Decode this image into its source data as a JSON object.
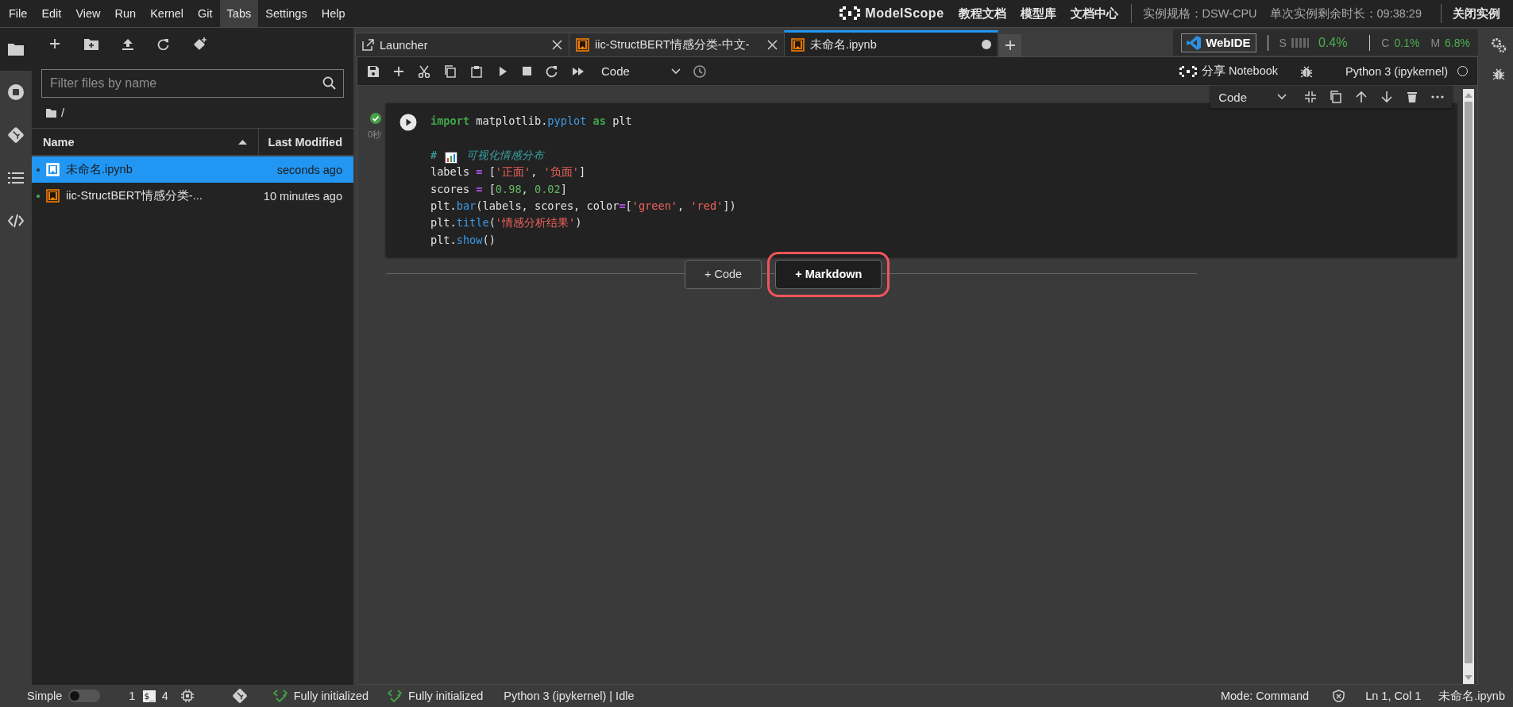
{
  "menu_bar": {
    "items": [
      {
        "label": "File",
        "selected": false
      },
      {
        "label": "Edit",
        "selected": false
      },
      {
        "label": "View",
        "selected": false
      },
      {
        "label": "Run",
        "selected": false
      },
      {
        "label": "Kernel",
        "selected": false
      },
      {
        "label": "Git",
        "selected": false
      },
      {
        "label": "Tabs",
        "selected": true
      },
      {
        "label": "Settings",
        "selected": false
      },
      {
        "label": "Help",
        "selected": false
      }
    ],
    "logo": "ModelScope",
    "links": [
      "教程文档",
      "模型库",
      "文档中心"
    ],
    "instance_spec": "实例规格：DSW-CPU",
    "remaining_time": "单次实例剩余时长：09:38:29",
    "close_button": "关闭实例"
  },
  "left_sidebar": {
    "tabs": [
      {
        "selected": true
      },
      {
        "selected": false
      },
      {
        "selected": false
      },
      {
        "selected": false
      },
      {
        "selected": false
      }
    ]
  },
  "file_browser": {
    "filter": {
      "placeholder": "Filter files by name"
    },
    "breadcrumb": "/",
    "columns": [
      {
        "label": "Name",
        "sorted": true
      },
      {
        "label": "Last Modified",
        "sorted": false
      }
    ],
    "rows": [
      {
        "name": "未命名.ipynb",
        "modified": "seconds ago",
        "selected": true,
        "running": true
      },
      {
        "name": "iic-StructBERT情感分类-...",
        "modified": "10 minutes ago",
        "selected": false,
        "running": true
      }
    ]
  },
  "dock": {
    "tabs": [
      {
        "label": "Launcher",
        "kind": "launcher",
        "selected": false,
        "dirty": false
      },
      {
        "label": "iic-StructBERT情感分类-中文-",
        "kind": "notebook",
        "selected": false,
        "dirty": false
      },
      {
        "label": "未命名.ipynb",
        "kind": "notebook",
        "selected": true,
        "dirty": true
      }
    ],
    "resources": {
      "webide_button": "WebIDE",
      "storage_label": "S",
      "storage_value": "0.4%",
      "cpu_label": "C",
      "cpu_value": "0.1%",
      "mem_label": "M",
      "mem_value": "6.8%"
    },
    "toolbar": {
      "cell_type": "Code",
      "share": "分享 Notebook",
      "kernel": "Python 3 (ipykernel)",
      "kernel_busy": false
    }
  },
  "cell": {
    "toolbar_cell_type": "Code",
    "succeeded": true,
    "elapsed": "0秒",
    "lines": [
      {
        "gap_before": false,
        "tokens": [
          {
            "text": "import",
            "kind": "kw"
          },
          {
            "text": " matplotlib.",
            "kind": "name"
          },
          {
            "text": "pyplot",
            "kind": "attr"
          },
          {
            "text": " as",
            "kind": "kw"
          },
          {
            "text": " plt",
            "kind": "name"
          }
        ]
      },
      {
        "gap_before": true,
        "tokens": [
          {
            "text": "# ",
            "kind": "comment"
          },
          {
            "kind": "icon"
          },
          {
            "text": " 可视化情感分布",
            "kind": "comment"
          }
        ]
      },
      {
        "gap_before": false,
        "tokens": [
          {
            "text": "labels ",
            "kind": "name"
          },
          {
            "text": "=",
            "kind": "op"
          },
          {
            "text": " [",
            "kind": "name"
          },
          {
            "text": "'正面'",
            "kind": "str"
          },
          {
            "text": ", ",
            "kind": "name"
          },
          {
            "text": "'负面'",
            "kind": "str"
          },
          {
            "text": "]",
            "kind": "name"
          }
        ]
      },
      {
        "gap_before": false,
        "tokens": [
          {
            "text": "scores ",
            "kind": "name"
          },
          {
            "text": "=",
            "kind": "op"
          },
          {
            "text": " [",
            "kind": "name"
          },
          {
            "text": "0.98",
            "kind": "num"
          },
          {
            "text": ", ",
            "kind": "name"
          },
          {
            "text": "0.02",
            "kind": "num"
          },
          {
            "text": "]",
            "kind": "name"
          }
        ]
      },
      {
        "gap_before": false,
        "tokens": [
          {
            "text": "plt.",
            "kind": "name"
          },
          {
            "text": "bar",
            "kind": "attr"
          },
          {
            "text": "(labels, scores, color",
            "kind": "name"
          },
          {
            "text": "=",
            "kind": "op"
          },
          {
            "text": "[",
            "kind": "name"
          },
          {
            "text": "'green'",
            "kind": "str"
          },
          {
            "text": ", ",
            "kind": "name"
          },
          {
            "text": "'red'",
            "kind": "str"
          },
          {
            "text": "])",
            "kind": "name"
          }
        ]
      },
      {
        "gap_before": false,
        "tokens": [
          {
            "text": "plt.",
            "kind": "name"
          },
          {
            "text": "title",
            "kind": "attr"
          },
          {
            "text": "(",
            "kind": "name"
          },
          {
            "text": "'情感分析结果'",
            "kind": "str"
          },
          {
            "text": ")",
            "kind": "name"
          }
        ]
      },
      {
        "gap_before": false,
        "tokens": [
          {
            "text": "plt.",
            "kind": "name"
          },
          {
            "text": "show",
            "kind": "attr"
          },
          {
            "text": "()",
            "kind": "name"
          }
        ]
      }
    ]
  },
  "add_buttons": [
    {
      "label": "+ Code",
      "highlighted": false
    },
    {
      "label": "+ Markdown",
      "highlighted": true
    }
  ],
  "status_bar": {
    "simple_mode": {
      "label": "Simple",
      "on": false
    },
    "terminals": "1",
    "terminal_icon": "$_",
    "kernels": "4",
    "init_1": "Fully initialized",
    "init_2": "Fully initialized",
    "kernel_status": "Python 3 (ipykernel) | Idle",
    "mode": "Mode: Command",
    "cursor": "Ln 1, Col 1",
    "file": "未命名.ipynb"
  }
}
